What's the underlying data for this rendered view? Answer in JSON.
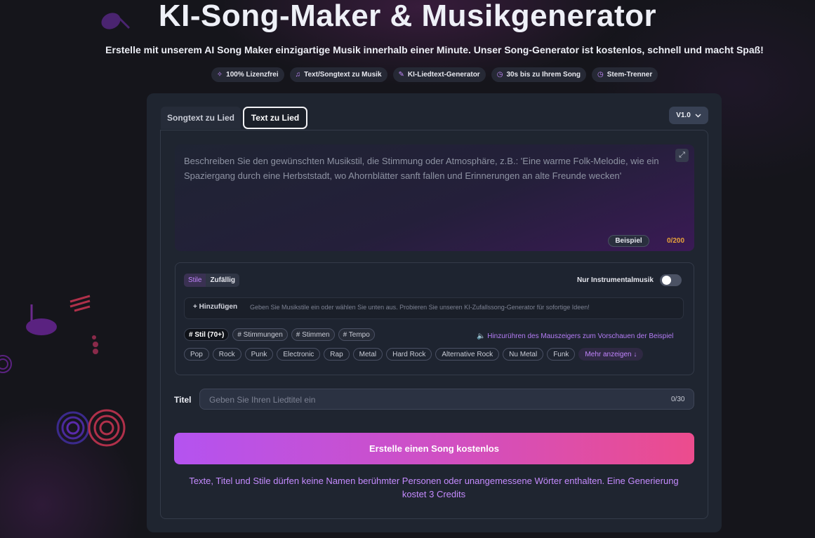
{
  "hero": {
    "title": "KI-Song-Maker & Musikgenerator",
    "subtitle": "Erstelle mit unserem AI Song Maker einzigartige Musik innerhalb einer Minute. Unser Song-Generator ist kostenlos, schnell und macht Spaß!"
  },
  "features": [
    {
      "icon": "sparkle-icon",
      "label": "100% Lizenzfrei"
    },
    {
      "icon": "music-note-icon",
      "label": "Text/Songtext zu Musik"
    },
    {
      "icon": "pen-icon",
      "label": "KI-Liedtext-Generator"
    },
    {
      "icon": "stopwatch-icon",
      "label": "30s bis zu Ihrem Song"
    },
    {
      "icon": "stopwatch-icon",
      "label": "Stem-Trenner"
    }
  ],
  "tabs": {
    "lyrics": "Songtext zu Lied",
    "text": "Text zu Lied"
  },
  "version": {
    "label": "V1.0"
  },
  "prompt": {
    "placeholder": "Beschreiben Sie den gewünschten Musikstil, die Stimmung oder Atmosphäre, z.B.: 'Eine warme Folk-Melodie, wie ein Spaziergang durch eine Herbststadt, wo Ahornblätter sanft fallen und Erinnerungen an alte Freunde wecken'",
    "example_label": "Beispiel",
    "counter": "0/200"
  },
  "styles": {
    "mode_styles": "Stile",
    "mode_random": "Zufällig",
    "instrumental_label": "Nur Instrumentalmusik",
    "instrumental_on": false,
    "add_label": "+ Hinzufügen",
    "add_placeholder": "Geben Sie Musikstile ein oder wählen Sie unten aus. Probieren Sie unseren KI-Zufallssong-Generator für sofortige Ideen!",
    "categories": [
      "# Stil (70+)",
      "# Stimmungen",
      "# Stimmen",
      "# Tempo"
    ],
    "hover_hint": "🔈 Hinzurühren des Mauszeigers zum Vorschauen der Beispiel",
    "genres": [
      "Pop",
      "Rock",
      "Punk",
      "Electronic",
      "Rap",
      "Metal",
      "Hard Rock",
      "Alternative Rock",
      "Nu Metal",
      "Funk"
    ],
    "more_label": "Mehr anzeigen ↓"
  },
  "title_field": {
    "label": "Titel",
    "placeholder": "Geben Sie Ihren Liedtitel ein",
    "counter": "0/30"
  },
  "create_button": "Erstelle einen Song kostenlos",
  "notice": "Texte, Titel und Stile dürfen keine Namen berühmter Personen oder unangemessene Wörter enthalten. Eine Generierung kostet 3 Credits",
  "colors": {
    "accent": "#c084fc",
    "button_start": "#b453f0",
    "button_end": "#ec4c8d",
    "counter": "#e7a23a"
  }
}
